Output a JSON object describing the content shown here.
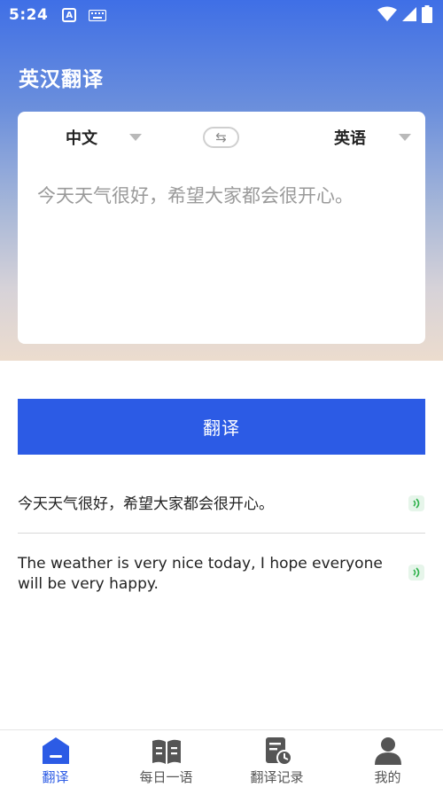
{
  "status_bar": {
    "time": "5:24",
    "notif_letter": "A"
  },
  "app": {
    "title": "英汉翻译"
  },
  "translator": {
    "source_language": "中文",
    "target_language": "英语",
    "swap_symbol": "⇆",
    "input_text": "今天天气很好，希望大家都会很开心。"
  },
  "actions": {
    "translate_label": "翻译"
  },
  "results": {
    "source_text": "今天天气很好，希望大家都会很开心。",
    "translated_text": "The weather is very nice today, I hope everyone will be very happy."
  },
  "tabs": [
    {
      "label": "翻译",
      "icon": "home-icon",
      "active": true
    },
    {
      "label": "每日一语",
      "icon": "book-icon",
      "active": false
    },
    {
      "label": "翻译记录",
      "icon": "history-icon",
      "active": false
    },
    {
      "label": "我的",
      "icon": "user-icon",
      "active": false
    }
  ],
  "colors": {
    "accent": "#2c5be5",
    "speak_icon": "#2fb24c"
  }
}
